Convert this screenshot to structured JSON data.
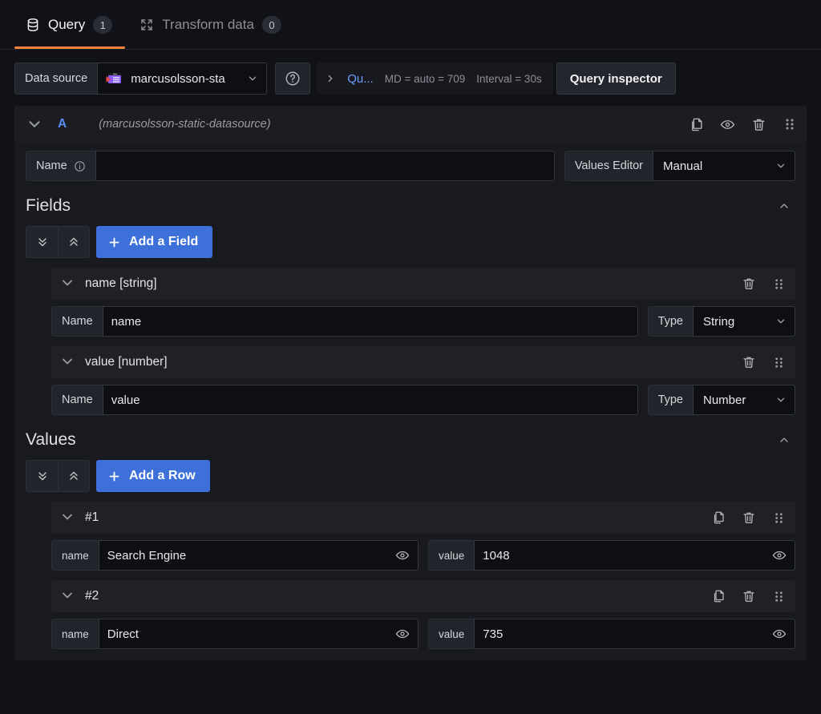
{
  "tabs": [
    {
      "label": "Query",
      "badge": "1",
      "icon": "database-icon",
      "active": true
    },
    {
      "label": "Transform data",
      "badge": "0",
      "icon": "transform-icon",
      "active": false
    }
  ],
  "toolbar": {
    "datasource_label": "Data source",
    "datasource_value": "marcusolsson-sta",
    "help_icon": "question-circle-icon",
    "query_options_label": "Qu...",
    "max_data_points": "MD = auto = 709",
    "interval": "Interval = 30s",
    "query_inspector_label": "Query inspector",
    "accent_blue": "#6e9fff",
    "accent_orange": "#f5833f",
    "primary_button": "#3d71d9"
  },
  "query": {
    "ref_id": "A",
    "datasource_name": "(marcusolsson-static-datasource)",
    "actions": [
      "copy-icon",
      "eye-icon",
      "trash-icon",
      "drag-handle-icon"
    ],
    "name_label": "Name",
    "name_value": "",
    "values_editor_label": "Values Editor",
    "values_editor_value": "Manual"
  },
  "fields_section": {
    "title": "Fields",
    "expand_all_icon": "chevrons-down-icon",
    "collapse_all_icon": "chevrons-up-icon",
    "add_button": "Add a Field",
    "items": [
      {
        "title": "name [string]",
        "name_label": "Name",
        "name_value": "name",
        "type_label": "Type",
        "type_value": "String"
      },
      {
        "title": "value [number]",
        "name_label": "Name",
        "name_value": "value",
        "type_label": "Type",
        "type_value": "Number"
      }
    ]
  },
  "values_section": {
    "title": "Values",
    "expand_all_icon": "chevrons-down-icon",
    "collapse_all_icon": "chevrons-up-icon",
    "add_button": "Add a Row",
    "rows": [
      {
        "title": "#1",
        "name_label": "name",
        "name_value": "Search Engine",
        "value_label": "value",
        "value_value": "1048"
      },
      {
        "title": "#2",
        "name_label": "name",
        "name_value": "Direct",
        "value_label": "value",
        "value_value": "735"
      }
    ]
  }
}
